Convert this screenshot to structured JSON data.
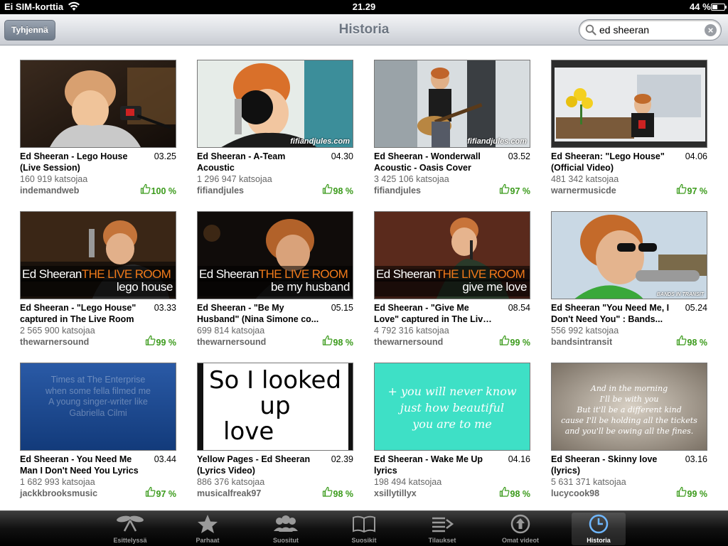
{
  "status_bar": {
    "carrier": "Ei SIM-korttia",
    "time": "21.29",
    "battery": "44 %",
    "battery_level": 0.44
  },
  "nav": {
    "clear_label": "Tyhjennä",
    "title": "Historia",
    "search_value": "ed sheeran"
  },
  "videos": [
    {
      "title": "Ed Sheeran - Lego House (Live Session)",
      "duration": "03.25",
      "views": "160 919 katsojaa",
      "channel": "indemandweb",
      "rating": "100 %"
    },
    {
      "title": "Ed Sheeran - A-Team Acoustic",
      "duration": "04.30",
      "views": "1 296 947 katsojaa",
      "channel": "fifiandjules",
      "rating": "98 %",
      "watermark": "fifiandjules.com"
    },
    {
      "title": "Ed Sheeran - Wonderwall Acoustic - Oasis Cover",
      "duration": "03.52",
      "views": "3 425 106 katsojaa",
      "channel": "fifiandjules",
      "rating": "97 %",
      "watermark": "fifiandjules.com"
    },
    {
      "title": "Ed Sheeran: \"Lego House\" (Official Video)",
      "duration": "04.06",
      "views": "481 342 katsojaa",
      "channel": "warnermusicde",
      "rating": "97 %"
    },
    {
      "title": "Ed Sheeran - \"Lego House\" captured in The Live Room",
      "duration": "03.33",
      "views": "2 565 900 katsojaa",
      "channel": "thewarnersound",
      "rating": "99 %",
      "overlay_name": "Ed Sheeran",
      "overlay_brand": "THE LIVE ROOM",
      "overlay_song": "lego house"
    },
    {
      "title": "Ed Sheeran - \"Be My Husband\" (Nina Simone co...",
      "duration": "05.15",
      "views": "699 814 katsojaa",
      "channel": "thewarnersound",
      "rating": "98 %",
      "overlay_name": "Ed Sheeran",
      "overlay_brand": "THE LIVE ROOM",
      "overlay_song": "be my husband"
    },
    {
      "title": "Ed Sheeran - \"Give Me Love\" captured in The Live Room",
      "duration": "08.54",
      "views": "4 792 316 katsojaa",
      "channel": "thewarnersound",
      "rating": "99 %",
      "overlay_name": "Ed Sheeran",
      "overlay_brand": "THE LIVE ROOM",
      "overlay_song": "give me love"
    },
    {
      "title": "Ed Sheeran \"You Need Me, I Don't Need You\" : Bands...",
      "duration": "05.24",
      "views": "556 992 katsojaa",
      "channel": "bandsintransit",
      "rating": "98 %",
      "watermark": "BANDS IN TRANSIT"
    },
    {
      "title": "Ed Sheeran - You Need Me Man I Don't Need You Lyrics",
      "duration": "03.44",
      "views": "1 682 993 katsojaa",
      "channel": "jackkbrooksmusic",
      "rating": "97 %",
      "thumb_text": [
        "Times at The Enterprise",
        "when some fella filmed me",
        "A young singer-writer like",
        "Gabriella Cilmi"
      ]
    },
    {
      "title": "Yellow Pages - Ed Sheeran (Lyrics Video)",
      "duration": "02.39",
      "views": "886 376 katsojaa",
      "channel": "musicalfreak97",
      "rating": "98 %",
      "thumb_text": [
        "So I looked up",
        "love"
      ]
    },
    {
      "title": "Ed Sheeran - Wake Me Up lyrics",
      "duration": "04.16",
      "views": "198 494 katsojaa",
      "channel": "xsillytillyx",
      "rating": "98 %",
      "thumb_text": [
        "+ you will never know",
        "just how beautiful",
        "you are to me"
      ]
    },
    {
      "title": "Ed Sheeran - Skinny love (lyrics)",
      "duration": "03.16",
      "views": "5 631 371 katsojaa",
      "channel": "lucycook98",
      "rating": "99 %",
      "thumb_text": [
        "And in the morning",
        "I'll be with you",
        "But it'll be a different kind",
        "cause I'll be holding all the tickets",
        "and you'll be owing all the fines."
      ]
    }
  ],
  "tabs": [
    {
      "label": "Esittelyssä",
      "icon": "featured-icon"
    },
    {
      "label": "Parhaat",
      "icon": "star-icon"
    },
    {
      "label": "Suositut",
      "icon": "people-icon"
    },
    {
      "label": "Suosikit",
      "icon": "book-icon"
    },
    {
      "label": "Tilaukset",
      "icon": "subscriptions-icon"
    },
    {
      "label": "Omat videot",
      "icon": "upload-icon"
    },
    {
      "label": "Historia",
      "icon": "clock-icon",
      "active": true
    }
  ],
  "colors": {
    "rating_green": "#3a9a1a",
    "live_room_orange": "#f07a1a",
    "tab_active_blue": "#6fb7ff"
  }
}
